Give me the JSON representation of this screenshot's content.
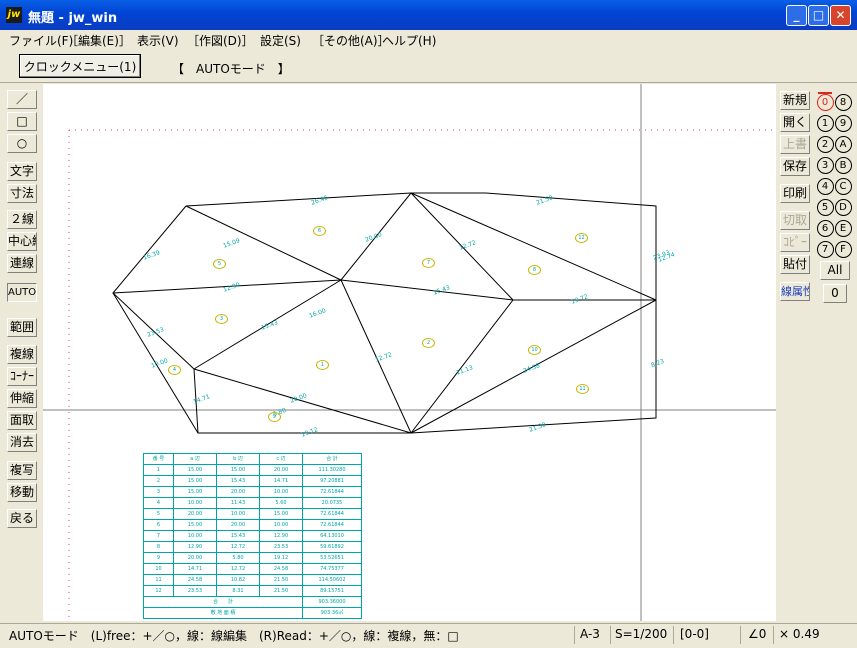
{
  "window": {
    "title": "無題 - jw_win",
    "app_icon_text": "jw",
    "minimize": "_",
    "maximize": "□",
    "close": "✕"
  },
  "menu": [
    "ファイル(F)",
    "［編集(E)］",
    "表示(V)",
    "［作図(D)］",
    "設定(S)",
    "［その他(A)］",
    "ヘルプ(H)"
  ],
  "toolbar": {
    "clock_menu": "クロックメニュー(1)",
    "mode": "【　AUTOモード　】"
  },
  "left_tools": {
    "line": "／",
    "rect": "□",
    "circle": "○",
    "text": "文字",
    "dimension": "寸法",
    "double_line": "２線",
    "center_line": "中心線",
    "chain_line": "連線",
    "auto": "AUTO",
    "range": "範囲",
    "copy_line": "複線",
    "corner": "ｺｰﾅｰ",
    "extend": "伸縮",
    "chamfer": "面取",
    "erase": "消去",
    "duplicate": "複写",
    "move": "移動",
    "undo": "戻る"
  },
  "right_tools": {
    "new": "新規",
    "open": "開く",
    "overwrite": "上書",
    "save": "保存",
    "print": "印刷",
    "cut": "切取",
    "copy": "ｺﾋﾟｰ",
    "paste": "貼付",
    "line_attr": "線属性"
  },
  "layers": {
    "col1": [
      "0",
      "1",
      "2",
      "3",
      "4",
      "5",
      "6",
      "7"
    ],
    "col2": [
      "8",
      "9",
      "A",
      "B",
      "C",
      "D",
      "E",
      "F"
    ],
    "all": "All",
    "group": "0"
  },
  "status": {
    "hint": "AUTOモード　(L)free：+／○，線：線編集　(R)Read：+／○，線：複線，無：□",
    "paper": "A-3",
    "scale": "S=1/200",
    "layer": "[0-0]",
    "angle": "∠0",
    "zoom": "× 0.49"
  },
  "drawing": {
    "edge_labels": [
      "26.46",
      "21.50",
      "16.39",
      "15.09",
      "20.00",
      "12.72",
      "15.43",
      "12.90",
      "23.53",
      "15.43",
      "13.72",
      "16.00",
      "12.72",
      "11.13",
      "20.00",
      "5.80",
      "10.00",
      "24.58",
      "8.23",
      "23.93",
      "19.12",
      "21.50",
      "14.71",
      "12.74"
    ],
    "triangle_labels": [
      "1",
      "2",
      "3",
      "4",
      "5",
      "6",
      "7",
      "8",
      "9",
      "10",
      "11",
      "12"
    ]
  },
  "area_table": {
    "headers": [
      "番 号",
      "a 辺",
      "b 辺",
      "c 辺",
      "合 計"
    ],
    "rows": [
      [
        "1",
        "15.00",
        "15.00",
        "20.00",
        "111.30280"
      ],
      [
        "2",
        "15.00",
        "15.43",
        "14.71",
        "97.20881"
      ],
      [
        "3",
        "15.00",
        "20.00",
        "10.00",
        "72.61844"
      ],
      [
        "4",
        "10.00",
        "11.43",
        "5.60",
        "20.0735"
      ],
      [
        "5",
        "20.00",
        "10.00",
        "15.00",
        "72.61844"
      ],
      [
        "6",
        "15.00",
        "20.00",
        "10.00",
        "72.61844"
      ],
      [
        "7",
        "10.00",
        "15.43",
        "12.90",
        "64.13010"
      ],
      [
        "8",
        "12.90",
        "12.72",
        "23.53",
        "59.61892"
      ],
      [
        "9",
        "20.00",
        "5.80",
        "19.12",
        "53.52651"
      ],
      [
        "10",
        "14.71",
        "12.72",
        "24.58",
        "74.75377"
      ],
      [
        "11",
        "24.58",
        "10.82",
        "21.50",
        "114.50602"
      ],
      [
        "12",
        "23.53",
        "8.31",
        "21.50",
        "89.15751"
      ]
    ],
    "total_label": "合　　計",
    "total_value": "903.36000",
    "tsubo_label": "敷 地 面 積",
    "tsubo_value": "903.36㎡"
  }
}
